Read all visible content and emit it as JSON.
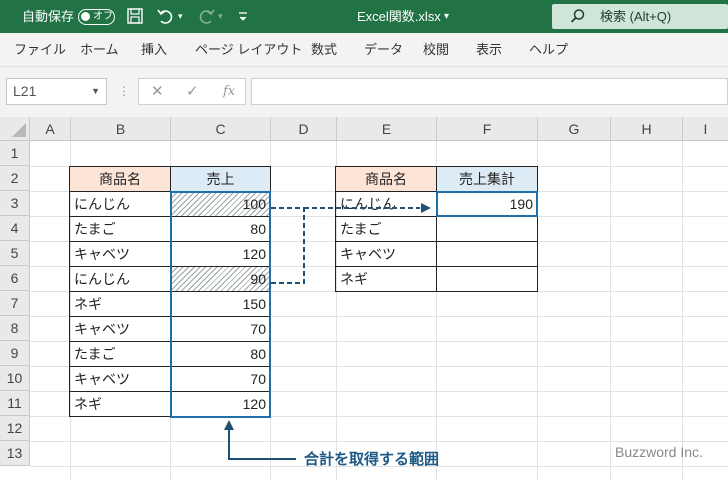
{
  "titlebar": {
    "autosave_label": "自動保存",
    "autosave_state": "オフ",
    "filename": "Excel関数.xlsx",
    "filename_caret": "▾",
    "search_placeholder": "検索 (Alt+Q)"
  },
  "ribbon": {
    "tabs": [
      "ファイル",
      "ホーム",
      "挿入",
      "ページ レイアウト",
      "数式",
      "データ",
      "校閲",
      "表示",
      "ヘルプ"
    ]
  },
  "formula_bar": {
    "name_box": "L21",
    "fx_label": "fx",
    "formula": ""
  },
  "columns": [
    "A",
    "B",
    "C",
    "D",
    "E",
    "F",
    "G",
    "H",
    "I"
  ],
  "rows": [
    "1",
    "2",
    "3",
    "4",
    "5",
    "6",
    "7",
    "8",
    "9",
    "10",
    "11",
    "12",
    "13"
  ],
  "table1": {
    "header_name": "商品名",
    "header_sales": "売上",
    "rows": [
      {
        "name": "にんじん",
        "sales": "100"
      },
      {
        "name": "たまご",
        "sales": "80"
      },
      {
        "name": "キャベツ",
        "sales": "120"
      },
      {
        "name": "にんじん",
        "sales": "90"
      },
      {
        "name": "ネギ",
        "sales": "150"
      },
      {
        "name": "キャベツ",
        "sales": "70"
      },
      {
        "name": "たまご",
        "sales": "80"
      },
      {
        "name": "キャベツ",
        "sales": "70"
      },
      {
        "name": "ネギ",
        "sales": "120"
      }
    ]
  },
  "table2": {
    "header_name": "商品名",
    "header_total": "売上集計",
    "rows": [
      {
        "name": "にんじん",
        "total": "190"
      },
      {
        "name": "たまご",
        "total": ""
      },
      {
        "name": "キャベツ",
        "total": ""
      },
      {
        "name": "ネギ",
        "total": ""
      }
    ]
  },
  "annotation": "合計を取得する範囲",
  "watermark": "Buzzword Inc.",
  "colors": {
    "excel_green": "#217346",
    "header_orange": "#fce4d6",
    "header_blue": "#ddebf7",
    "annotation_blue": "#1f5a86"
  }
}
